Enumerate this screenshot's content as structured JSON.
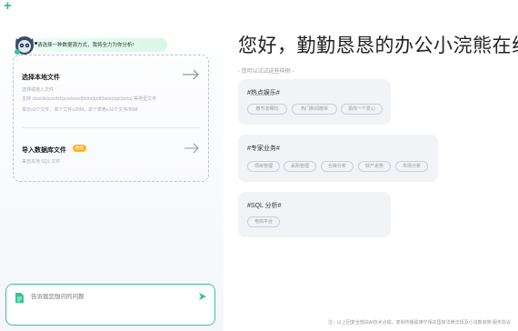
{
  "sidebar": {
    "greeting": "请选择一种数据源方式，我将全力为你分析!",
    "sources": [
      {
        "title": "选择本地文件",
        "desc": "选择或拖入文件",
        "formats": "支持 xlsx/xls/csv/txt/json/word(beta)/pdf(beta)/ppt(beta) 等类型文件",
        "limits": "单次≤3个文件，单个文件≤20M，单个表格≤10个文件/80M"
      },
      {
        "title": "导入数据库文件",
        "badge": "推荐",
        "desc": "来自本地 SQL 文件"
      }
    ],
    "input_placeholder": "告诉我您想问的问题"
  },
  "main": {
    "title": "您好，勤勤恳恳的办公小浣熊在线!",
    "try_label": "- 您可以试试这些样例 -",
    "cards": [
      {
        "title": "#热点娱乐#",
        "tags": [
          "春节去哪玩",
          "热门新闻榜单",
          "猜你一个爱心"
        ]
      },
      {
        "title": "#专家业务#",
        "tags": [
          "项目管理",
          "采购管理",
          "仓库分析",
          "财产走势",
          "市场分析"
        ]
      },
      {
        "title": "#SQL 分析#",
        "tags": [
          "电商平台"
        ]
      }
    ],
    "footer": "注：以上回复全部由AI技术合成，复制传播需遵守相关国家法律法规及小浣熊家族 服务协议"
  },
  "colors": {
    "accent": "#37c68c",
    "badge": "#ffb11b"
  }
}
